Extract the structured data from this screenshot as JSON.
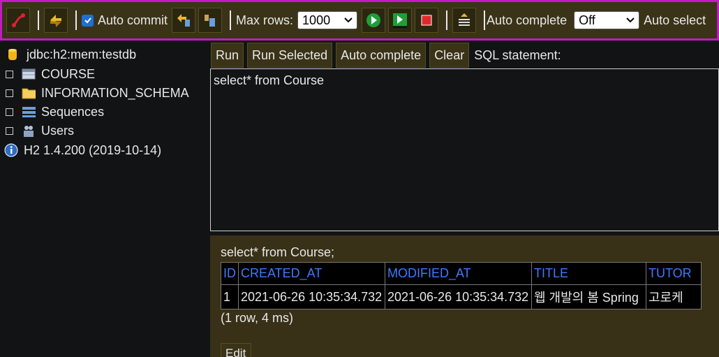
{
  "toolbar": {
    "auto_commit_label": "Auto commit",
    "max_rows_label": "Max rows:",
    "max_rows_value": "1000",
    "auto_complete_label": "Auto complete",
    "auto_complete_value": "Off",
    "auto_select_label": "Auto select"
  },
  "tree": {
    "connection": "jdbc:h2:mem:testdb",
    "items": [
      "COURSE",
      "INFORMATION_SCHEMA",
      "Sequences",
      "Users"
    ],
    "version": "H2 1.4.200 (2019-10-14)"
  },
  "query": {
    "run_label": "Run",
    "run_selected_label": "Run Selected",
    "auto_complete_label": "Auto complete",
    "clear_label": "Clear",
    "sql_label": "SQL statement:",
    "editor_text": "select* from Course"
  },
  "results": {
    "query_text": "select* from Course;",
    "columns": [
      "ID",
      "CREATED_AT",
      "MODIFIED_AT",
      "TITLE",
      "TUTOR"
    ],
    "rows": [
      [
        "1",
        "2021-06-26 10:35:34.732",
        "2021-06-26 10:35:34.732",
        "웹 개발의 봄 Spring",
        "고로케"
      ]
    ],
    "summary": "(1 row, 4 ms)",
    "edit_label": "Edit"
  },
  "colors": {
    "accent_border": "#c11bc1",
    "header_link": "#3c7bff",
    "panel": "#383017"
  }
}
